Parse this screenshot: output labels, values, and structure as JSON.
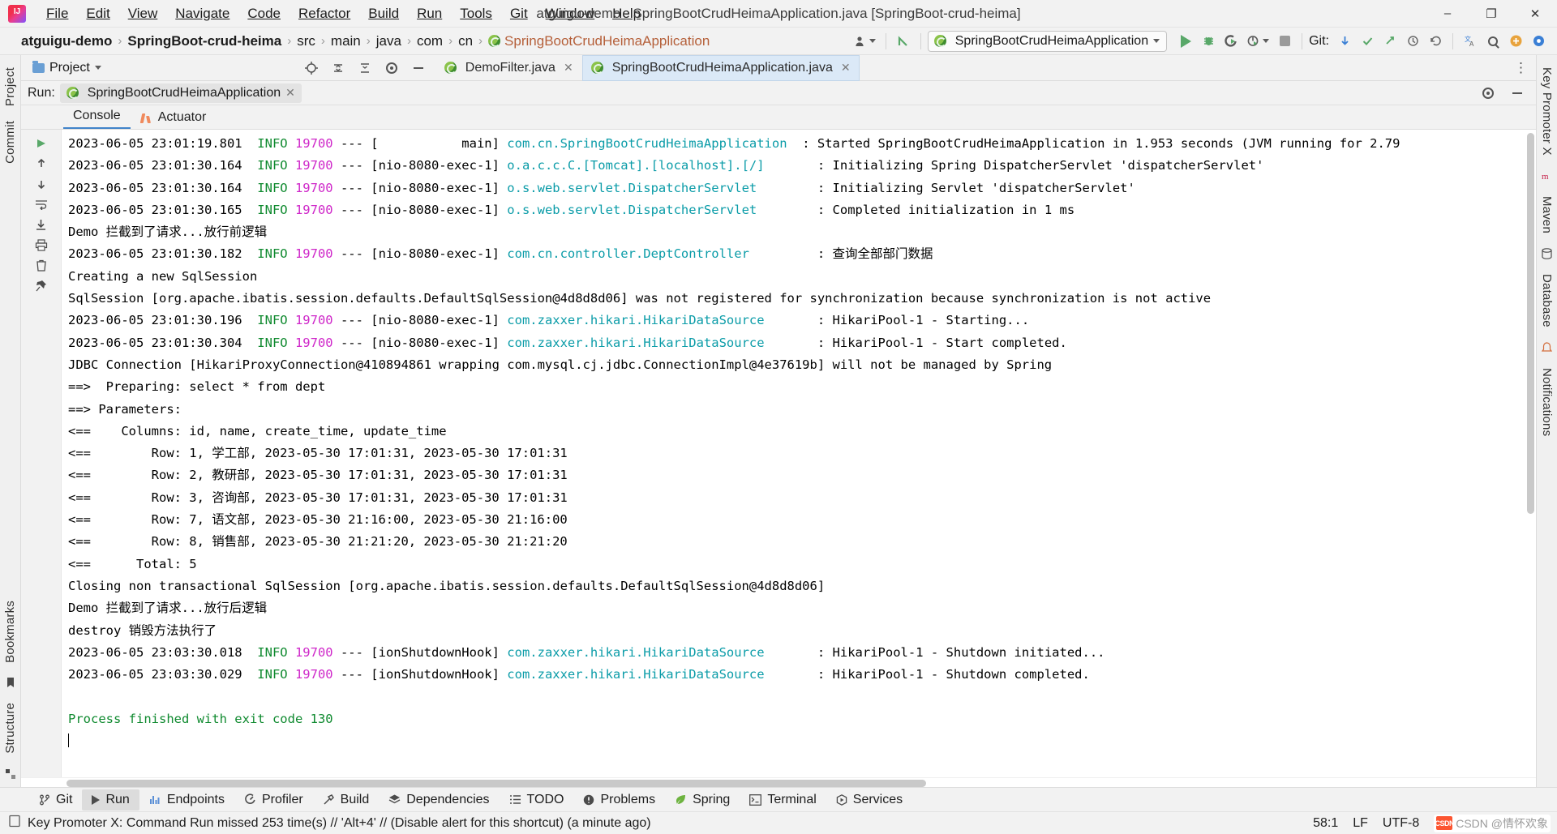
{
  "window": {
    "title": "atguigu-demo - SpringBootCrudHeimaApplication.java [SpringBoot-crud-heima]",
    "minimize": "–",
    "maximize": "❐",
    "close": "✕"
  },
  "menubar": {
    "items": [
      "File",
      "Edit",
      "View",
      "Navigate",
      "Code",
      "Refactor",
      "Build",
      "Run",
      "Tools",
      "Git",
      "Window",
      "Help"
    ]
  },
  "breadcrumb": {
    "items": [
      {
        "label": "atguigu-demo",
        "style": "bold"
      },
      {
        "label": "SpringBoot-crud-heima",
        "style": "bold"
      },
      {
        "label": "src",
        "style": "plain"
      },
      {
        "label": "main",
        "style": "plain"
      },
      {
        "label": "java",
        "style": "plain"
      },
      {
        "label": "com",
        "style": "plain"
      },
      {
        "label": "cn",
        "style": "plain"
      },
      {
        "label": "SpringBootCrudHeimaApplication",
        "style": "highlight"
      }
    ],
    "separator": "›"
  },
  "toolbar": {
    "run_config": "SpringBootCrudHeimaApplication",
    "run_label": "Run",
    "debug_label": "Debug",
    "run_coverage_label": "Run with Coverage",
    "profiler_label": "Profiler",
    "stop_label": "Stop",
    "git_label": "Git:",
    "update_project_label": "Update Project",
    "commit_label": "Commit",
    "push_label": "Push",
    "history_label": "History",
    "rollback_label": "Rollback",
    "translate_label": "Translate",
    "search_label": "Search Everywhere",
    "account_label": "Account",
    "settings_label": "Settings"
  },
  "project_bar": {
    "title": "Project",
    "editor_tabs": [
      {
        "label": "DemoFilter.java",
        "active": false,
        "close": "✕"
      },
      {
        "label": "SpringBootCrudHeimaApplication.java",
        "active": true,
        "close": "✕"
      }
    ],
    "more": "⋮"
  },
  "run_window": {
    "run_label": "Run:",
    "tab_name": "SpringBootCrudHeimaApplication",
    "tab_close": "✕",
    "settings_icon": "gear-icon",
    "hide_icon": "minimize-icon",
    "tabs": [
      {
        "label": "Console",
        "active": true
      },
      {
        "label": "Actuator",
        "active": false
      }
    ]
  },
  "console": {
    "lines": [
      [
        {
          "t": "2023-06-05 23:01:19.801  ",
          "c": "plain"
        },
        {
          "t": "INFO",
          "c": "info"
        },
        {
          "t": " ",
          "c": "plain"
        },
        {
          "t": "19700",
          "c": "pid"
        },
        {
          "t": " --- [           main] ",
          "c": "plain"
        },
        {
          "t": "com.cn.SpringBootCrudHeimaApplication",
          "c": "cls"
        },
        {
          "t": "  : Started SpringBootCrudHeimaApplication in 1.953 seconds (JVM running for 2.79",
          "c": "plain"
        }
      ],
      [
        {
          "t": "2023-06-05 23:01:30.164  ",
          "c": "plain"
        },
        {
          "t": "INFO",
          "c": "info"
        },
        {
          "t": " ",
          "c": "plain"
        },
        {
          "t": "19700",
          "c": "pid"
        },
        {
          "t": " --- [nio-8080-exec-1] ",
          "c": "plain"
        },
        {
          "t": "o.a.c.c.C.[Tomcat].[localhost].[/]",
          "c": "cls"
        },
        {
          "t": "       : Initializing Spring DispatcherServlet 'dispatcherServlet'",
          "c": "plain"
        }
      ],
      [
        {
          "t": "2023-06-05 23:01:30.164  ",
          "c": "plain"
        },
        {
          "t": "INFO",
          "c": "info"
        },
        {
          "t": " ",
          "c": "plain"
        },
        {
          "t": "19700",
          "c": "pid"
        },
        {
          "t": " --- [nio-8080-exec-1] ",
          "c": "plain"
        },
        {
          "t": "o.s.web.servlet.DispatcherServlet",
          "c": "cls"
        },
        {
          "t": "        : Initializing Servlet 'dispatcherServlet'",
          "c": "plain"
        }
      ],
      [
        {
          "t": "2023-06-05 23:01:30.165  ",
          "c": "plain"
        },
        {
          "t": "INFO",
          "c": "info"
        },
        {
          "t": " ",
          "c": "plain"
        },
        {
          "t": "19700",
          "c": "pid"
        },
        {
          "t": " --- [nio-8080-exec-1] ",
          "c": "plain"
        },
        {
          "t": "o.s.web.servlet.DispatcherServlet",
          "c": "cls"
        },
        {
          "t": "        : Completed initialization in 1 ms",
          "c": "plain"
        }
      ],
      [
        {
          "t": "Demo 拦截到了请求...放行前逻辑",
          "c": "plain"
        }
      ],
      [
        {
          "t": "2023-06-05 23:01:30.182  ",
          "c": "plain"
        },
        {
          "t": "INFO",
          "c": "info"
        },
        {
          "t": " ",
          "c": "plain"
        },
        {
          "t": "19700",
          "c": "pid"
        },
        {
          "t": " --- [nio-8080-exec-1] ",
          "c": "plain"
        },
        {
          "t": "com.cn.controller.DeptController",
          "c": "cls"
        },
        {
          "t": "         : 查询全部部门数据",
          "c": "plain"
        }
      ],
      [
        {
          "t": "Creating a new SqlSession",
          "c": "plain"
        }
      ],
      [
        {
          "t": "SqlSession [org.apache.ibatis.session.defaults.DefaultSqlSession@4d8d8d06] was not registered for synchronization because synchronization is not active",
          "c": "plain"
        }
      ],
      [
        {
          "t": "2023-06-05 23:01:30.196  ",
          "c": "plain"
        },
        {
          "t": "INFO",
          "c": "info"
        },
        {
          "t": " ",
          "c": "plain"
        },
        {
          "t": "19700",
          "c": "pid"
        },
        {
          "t": " --- [nio-8080-exec-1] ",
          "c": "plain"
        },
        {
          "t": "com.zaxxer.hikari.HikariDataSource",
          "c": "cls"
        },
        {
          "t": "       : HikariPool-1 - Starting...",
          "c": "plain"
        }
      ],
      [
        {
          "t": "2023-06-05 23:01:30.304  ",
          "c": "plain"
        },
        {
          "t": "INFO",
          "c": "info"
        },
        {
          "t": " ",
          "c": "plain"
        },
        {
          "t": "19700",
          "c": "pid"
        },
        {
          "t": " --- [nio-8080-exec-1] ",
          "c": "plain"
        },
        {
          "t": "com.zaxxer.hikari.HikariDataSource",
          "c": "cls"
        },
        {
          "t": "       : HikariPool-1 - Start completed.",
          "c": "plain"
        }
      ],
      [
        {
          "t": "JDBC Connection [HikariProxyConnection@410894861 wrapping com.mysql.cj.jdbc.ConnectionImpl@4e37619b] will not be managed by Spring",
          "c": "plain"
        }
      ],
      [
        {
          "t": "==>  Preparing: select * from dept",
          "c": "plain"
        }
      ],
      [
        {
          "t": "==> Parameters: ",
          "c": "plain"
        }
      ],
      [
        {
          "t": "<==    Columns: id, name, create_time, update_time",
          "c": "plain"
        }
      ],
      [
        {
          "t": "<==        Row: 1, 学工部, 2023-05-30 17:01:31, 2023-05-30 17:01:31",
          "c": "plain"
        }
      ],
      [
        {
          "t": "<==        Row: 2, 教研部, 2023-05-30 17:01:31, 2023-05-30 17:01:31",
          "c": "plain"
        }
      ],
      [
        {
          "t": "<==        Row: 3, 咨询部, 2023-05-30 17:01:31, 2023-05-30 17:01:31",
          "c": "plain"
        }
      ],
      [
        {
          "t": "<==        Row: 7, 语文部, 2023-05-30 21:16:00, 2023-05-30 21:16:00",
          "c": "plain"
        }
      ],
      [
        {
          "t": "<==        Row: 8, 销售部, 2023-05-30 21:21:20, 2023-05-30 21:21:20",
          "c": "plain"
        }
      ],
      [
        {
          "t": "<==      Total: 5",
          "c": "plain"
        }
      ],
      [
        {
          "t": "Closing non transactional SqlSession [org.apache.ibatis.session.defaults.DefaultSqlSession@4d8d8d06]",
          "c": "plain"
        }
      ],
      [
        {
          "t": "Demo 拦截到了请求...放行后逻辑",
          "c": "plain"
        }
      ],
      [
        {
          "t": "destroy 销毁方法执行了",
          "c": "plain"
        }
      ],
      [
        {
          "t": "2023-06-05 23:03:30.018  ",
          "c": "plain"
        },
        {
          "t": "INFO",
          "c": "info"
        },
        {
          "t": " ",
          "c": "plain"
        },
        {
          "t": "19700",
          "c": "pid"
        },
        {
          "t": " --- [ionShutdownHook] ",
          "c": "plain"
        },
        {
          "t": "com.zaxxer.hikari.HikariDataSource",
          "c": "cls"
        },
        {
          "t": "       : HikariPool-1 - Shutdown initiated...",
          "c": "plain"
        }
      ],
      [
        {
          "t": "2023-06-05 23:03:30.029  ",
          "c": "plain"
        },
        {
          "t": "INFO",
          "c": "info"
        },
        {
          "t": " ",
          "c": "plain"
        },
        {
          "t": "19700",
          "c": "pid"
        },
        {
          "t": " --- [ionShutdownHook] ",
          "c": "plain"
        },
        {
          "t": "com.zaxxer.hikari.HikariDataSource",
          "c": "cls"
        },
        {
          "t": "       : HikariPool-1 - Shutdown completed.",
          "c": "plain"
        }
      ],
      [
        {
          "t": "",
          "c": "plain"
        }
      ],
      [
        {
          "t": "Process finished with exit code 130",
          "c": "ok"
        }
      ]
    ]
  },
  "left_strip": {
    "items": [
      {
        "label": "Project",
        "type": "label"
      },
      {
        "label": "Commit",
        "type": "label"
      },
      {
        "label": "Bookmarks",
        "type": "label"
      },
      {
        "label": "Structure",
        "type": "label"
      }
    ]
  },
  "right_strip": {
    "items": [
      {
        "label": "Key Promoter X",
        "type": "label"
      },
      {
        "label": "Maven",
        "type": "label"
      },
      {
        "label": "Database",
        "type": "label"
      },
      {
        "label": "Notifications",
        "type": "label"
      }
    ]
  },
  "bottom_tabs": [
    {
      "label": "Git",
      "icon": "git-branch-icon",
      "active": false
    },
    {
      "label": "Run",
      "icon": "run-play-icon",
      "active": true
    },
    {
      "label": "Endpoints",
      "icon": "endpoints-icon",
      "active": false
    },
    {
      "label": "Profiler",
      "icon": "profiler-icon",
      "active": false
    },
    {
      "label": "Build",
      "icon": "hammer-icon",
      "active": false
    },
    {
      "label": "Dependencies",
      "icon": "layers-icon",
      "active": false
    },
    {
      "label": "TODO",
      "icon": "list-icon",
      "active": false
    },
    {
      "label": "Problems",
      "icon": "warning-icon",
      "active": false
    },
    {
      "label": "Spring",
      "icon": "spring-leaf-icon",
      "active": false
    },
    {
      "label": "Terminal",
      "icon": "terminal-icon",
      "active": false
    },
    {
      "label": "Services",
      "icon": "services-icon",
      "active": false
    }
  ],
  "status": {
    "message": "Key Promoter X: Command Run missed 253 time(s) // 'Alt+4' // (Disable alert for this shortcut) (a minute ago)",
    "caret": "58:1",
    "line_separator": "LF",
    "encoding": "UTF-8",
    "watermark": "CSDN @情怀欢象",
    "csdn": "CSDN"
  },
  "colors": {
    "accent": "#4083c9",
    "green": "#59a869",
    "info": "#0f8a2f",
    "pid": "#cf27c9",
    "class": "#0b9ca8",
    "highlight": "#b5603a"
  }
}
